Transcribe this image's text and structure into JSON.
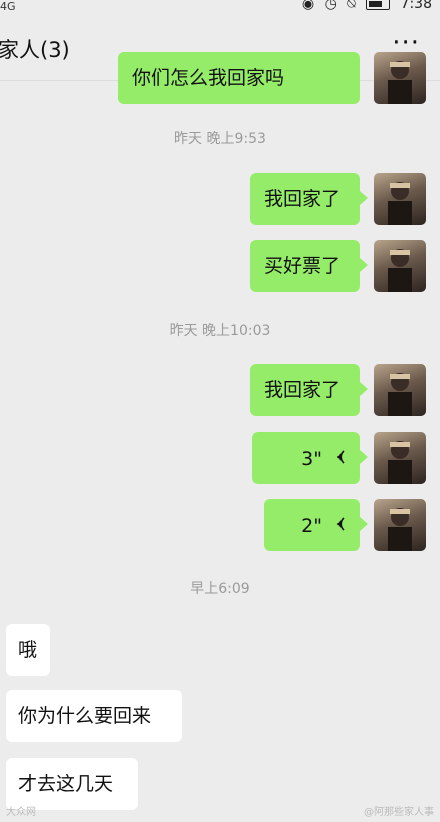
{
  "status": {
    "signal": "4G",
    "time": "7:38"
  },
  "header": {
    "title": "家人(3)",
    "more": "···"
  },
  "messages": {
    "top_partial": "你们怎么我回家吗",
    "ts1": "昨天 晚上9:53",
    "m1": "我回家了",
    "m2": "买好票了",
    "ts2": "昨天 晚上10:03",
    "m3": "我回家了",
    "v1": "3\"",
    "v2": "2\"",
    "ts3": "早上6:09",
    "in1": "哦",
    "in2": "你为什么要回来",
    "in3": "才去这几天"
  },
  "watermark": {
    "left": "大众网",
    "right": "@阿那些家人事"
  }
}
